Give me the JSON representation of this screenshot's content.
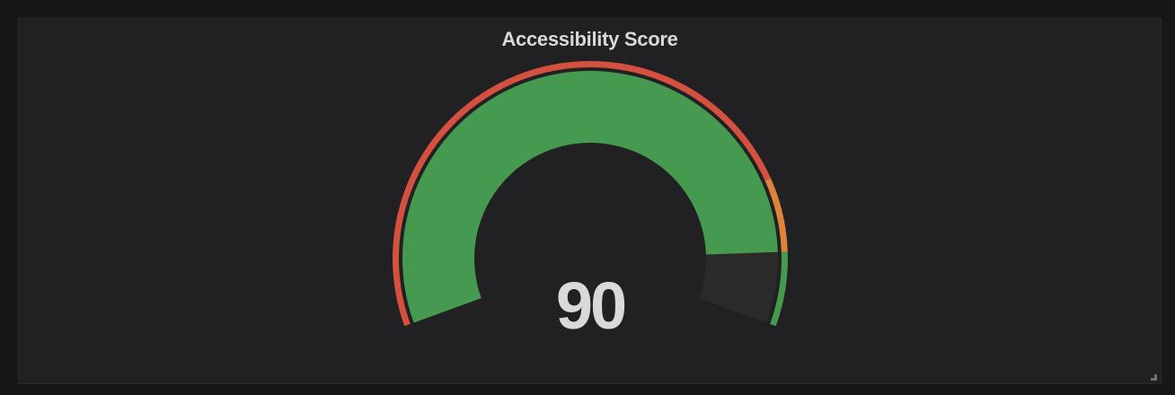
{
  "panel": {
    "title": "Accessibility Score"
  },
  "gauge": {
    "value": 90,
    "display_value": "90",
    "min": 0,
    "max": 100,
    "value_color": "#469a50",
    "track_color": "#2a2a2a",
    "thresholds": [
      {
        "from": 0,
        "to": 80,
        "color": "#d4503f"
      },
      {
        "from": 80,
        "to": 90,
        "color": "#e0833a"
      },
      {
        "from": 90,
        "to": 100,
        "color": "#469a50"
      }
    ]
  },
  "icons": {
    "resize": "resize-handle-icon"
  }
}
